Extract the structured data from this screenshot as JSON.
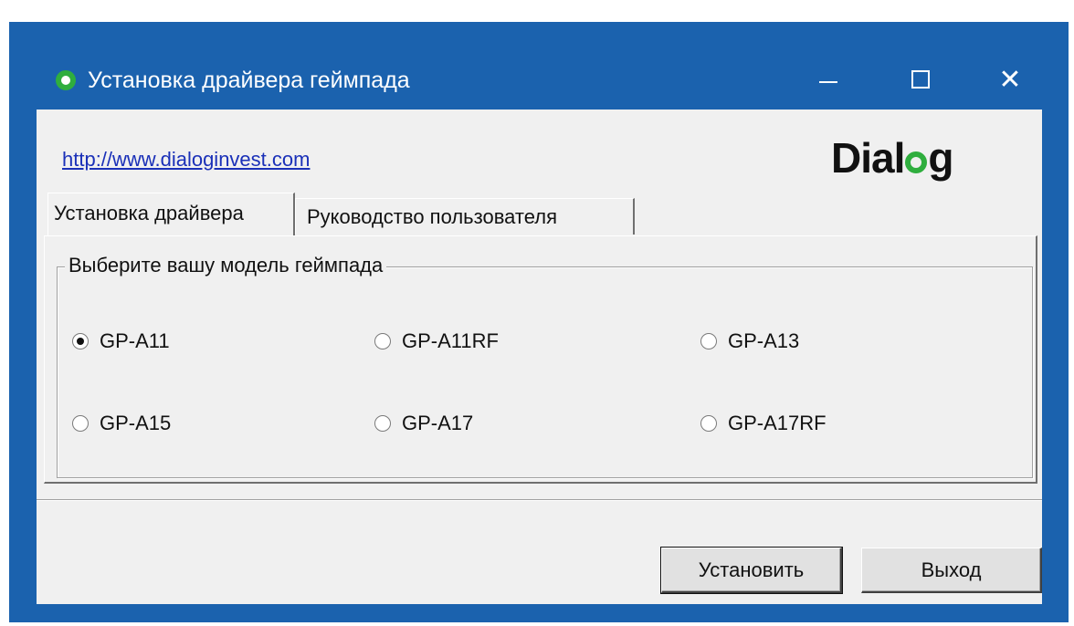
{
  "window": {
    "title": "Установка драйвера геймпада",
    "controls": {
      "minimize": "—",
      "maximize": "□",
      "close": "✕"
    }
  },
  "header": {
    "link": "http://www.dialoginvest.com",
    "logo_prefix": "Dial",
    "logo_suffix": "g"
  },
  "tabs": [
    {
      "label": "Установка драйвера",
      "active": true
    },
    {
      "label": "Руководство пользователя",
      "active": false
    }
  ],
  "group": {
    "legend": "Выберите вашу модель геймпада",
    "options": [
      {
        "label": "GP-A11",
        "checked": true
      },
      {
        "label": "GP-A11RF",
        "checked": false
      },
      {
        "label": "GP-A13",
        "checked": false
      },
      {
        "label": "GP-A15",
        "checked": false
      },
      {
        "label": "GP-A17",
        "checked": false
      },
      {
        "label": "GP-A17RF",
        "checked": false
      }
    ]
  },
  "buttons": {
    "install": "Установить",
    "exit": "Выход"
  },
  "colors": {
    "titlebar": "#1b62ae",
    "accent_green": "#2fae3e",
    "link": "#1a30b8"
  }
}
